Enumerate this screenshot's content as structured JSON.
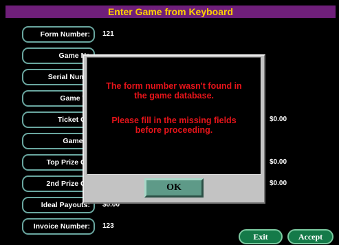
{
  "window": {
    "title": "Enter Game from Keyboard"
  },
  "fields": [
    {
      "label": "Form Number:",
      "value": "121"
    },
    {
      "label": "Game Na",
      "value": ""
    },
    {
      "label": "Serial Numb",
      "value": ""
    },
    {
      "label": "Game Ty",
      "value": ""
    },
    {
      "label": "Ticket Co",
      "value": "$0.00"
    },
    {
      "label": "Game C",
      "value": ""
    },
    {
      "label": "Top Prize Co",
      "value": "$0.00"
    },
    {
      "label": "2nd Prize Co",
      "value": "$0.00"
    },
    {
      "label": "Ideal Payouts:",
      "value": "$0.00"
    },
    {
      "label": "Invoice Number:",
      "value": "123"
    }
  ],
  "dialog": {
    "message_line1": "The form number wasn't found in",
    "message_line2": "the game database.",
    "message_line3": "Please fill in the missing fields",
    "message_line4": "before proceeding.",
    "ok_label": "OK"
  },
  "buttons": {
    "exit_label": "Exit",
    "accept_label": "Accept"
  },
  "colors": {
    "title_bg": "#6f1f7a",
    "title_text": "#ffd200",
    "field_border": "#6aa7a0",
    "message_text": "#e8141a",
    "button_green": "#157a49"
  }
}
